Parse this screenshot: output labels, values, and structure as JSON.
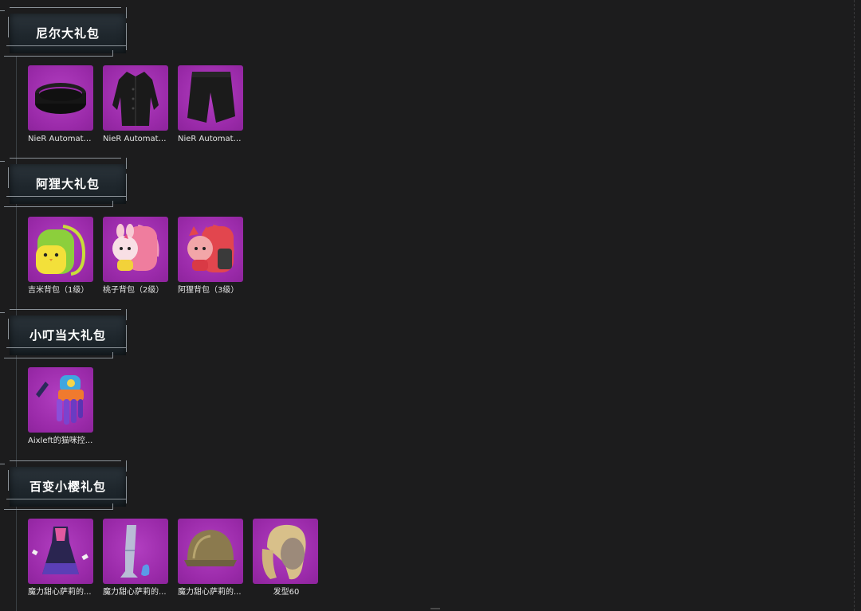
{
  "sections": [
    {
      "title": "尼尔大礼包",
      "items": [
        {
          "name": "NieR Automata...",
          "icon": "black-belt-icon"
        },
        {
          "name": "NieR Automata...",
          "icon": "black-coat-icon"
        },
        {
          "name": "NieR Automata...",
          "icon": "black-shorts-icon"
        }
      ]
    },
    {
      "title": "阿狸大礼包",
      "items": [
        {
          "name": "吉米背包（1级）",
          "icon": "green-chick-backpack-icon"
        },
        {
          "name": "桃子背包（2级）",
          "icon": "pink-bunny-backpack-icon"
        },
        {
          "name": "阿狸背包（3级）",
          "icon": "red-fox-backpack-icon"
        }
      ]
    },
    {
      "title": "小叮当大礼包",
      "items": [
        {
          "name": "Aixleft的猫咪控...",
          "icon": "cat-glove-icon"
        }
      ]
    },
    {
      "title": "百变小樱礼包",
      "items": [
        {
          "name": "魔力甜心萨莉的...",
          "icon": "magic-dress-icon"
        },
        {
          "name": "魔力甜心萨莉的...",
          "icon": "magic-boots-icon"
        },
        {
          "name": "魔力甜心萨莉的...",
          "icon": "bronze-helmet-icon"
        },
        {
          "name": "发型60",
          "icon": "blonde-hairstyle-icon"
        }
      ]
    }
  ],
  "colors": {
    "background": "#1c1c1d",
    "tile": "#9a2aa9",
    "header_plate": "#222a30",
    "text": "#e6e6e6"
  }
}
